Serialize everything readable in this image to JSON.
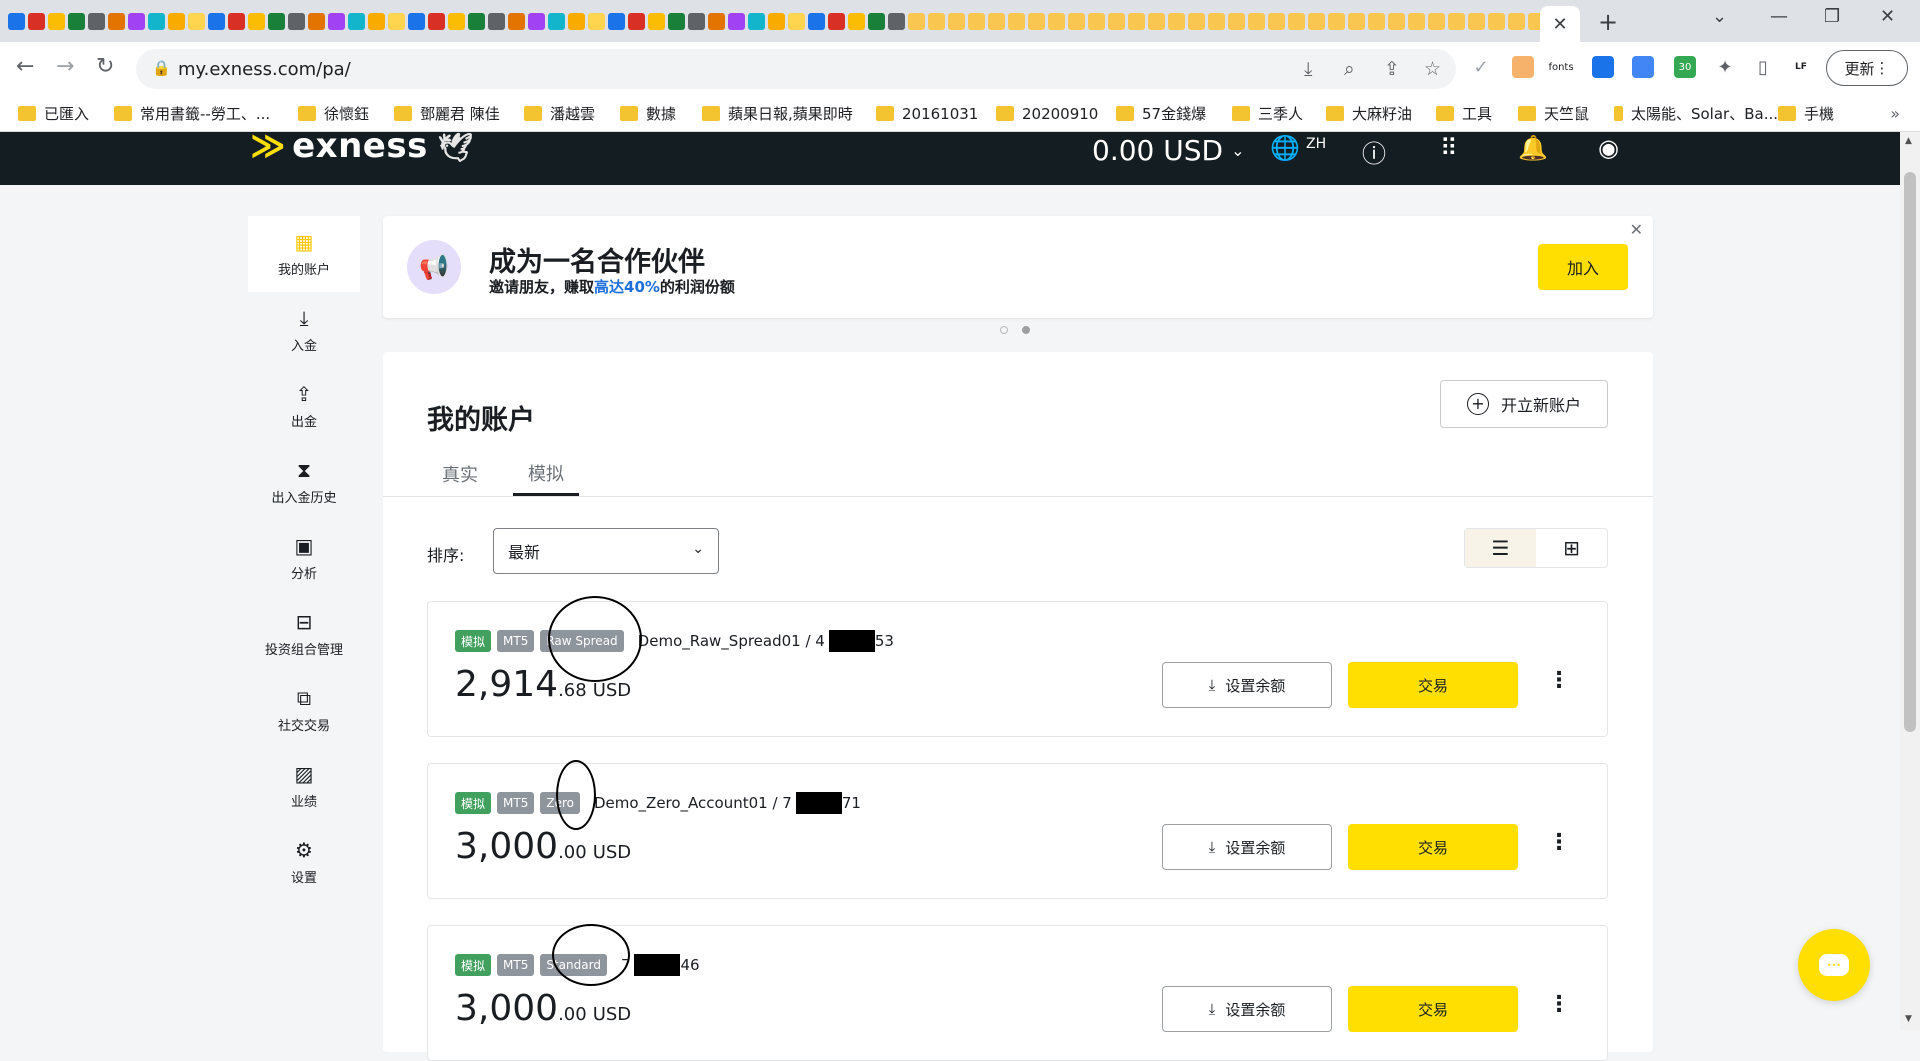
{
  "browser": {
    "url": "my.exness.com/pa/",
    "update_label": "更新",
    "ext_fonts_label": "fonts",
    "ext_badge": "30",
    "bookmarks": [
      "已匯入",
      "常用書籤--勞工、...",
      "徐懷鈺",
      "鄧麗君 陳佳",
      "潘越雲",
      "數據",
      "蘋果日報,蘋果即時",
      "20161031",
      "20200910",
      "57金錢爆",
      "三季人",
      "大麻籽油",
      "工具",
      "天竺鼠",
      "太陽能、Solar、Ba...",
      "手機"
    ]
  },
  "header": {
    "logo": "exness",
    "balance": "0.00 USD",
    "lang": "ZH"
  },
  "sidebar": {
    "items": [
      {
        "label": "我的账户",
        "icon": "grid-icon"
      },
      {
        "label": "入金",
        "icon": "download-icon"
      },
      {
        "label": "出金",
        "icon": "upload-icon"
      },
      {
        "label": "出入金历史",
        "icon": "hourglass-icon"
      },
      {
        "label": "分析",
        "icon": "chart-icon"
      },
      {
        "label": "投资组合管理",
        "icon": "briefcase-icon"
      },
      {
        "label": "社交交易",
        "icon": "copy-icon"
      },
      {
        "label": "业绩",
        "icon": "pulse-icon"
      },
      {
        "label": "设置",
        "icon": "gear-icon"
      }
    ]
  },
  "banner": {
    "title": "成为一名合作伙伴",
    "sub_before": "邀请朋友，赚取",
    "sub_highlight": "高达40%",
    "sub_after": "的利润份额",
    "join_label": "加入"
  },
  "main": {
    "title": "我的账户",
    "open_account_label": "开立新账户",
    "tabs": [
      "真实",
      "模拟"
    ],
    "active_tab": "模拟",
    "sort_label": "排序:",
    "sort_value": "最新"
  },
  "accounts": [
    {
      "tag_demo": "模拟",
      "tag_platform": "MT5",
      "tag_type": "Raw Spread",
      "name": "Demo_Raw_Spread01 / 4",
      "num_tail": "53",
      "balance_int": "2,914",
      "balance_dec": ".68",
      "currency": "USD",
      "set_balance_label": "设置余额",
      "trade_label": "交易"
    },
    {
      "tag_demo": "模拟",
      "tag_platform": "MT5",
      "tag_type": "Zero",
      "name": "Demo_Zero_Account01 / 7",
      "num_tail": "71",
      "balance_int": "3,000",
      "balance_dec": ".00",
      "currency": "USD",
      "set_balance_label": "设置余额",
      "trade_label": "交易"
    },
    {
      "tag_demo": "模拟",
      "tag_platform": "MT5",
      "tag_type": "Standard",
      "name": "7",
      "num_tail": "46",
      "balance_int": "3,000",
      "balance_dec": ".00",
      "currency": "USD",
      "set_balance_label": "设置余额",
      "trade_label": "交易"
    }
  ]
}
